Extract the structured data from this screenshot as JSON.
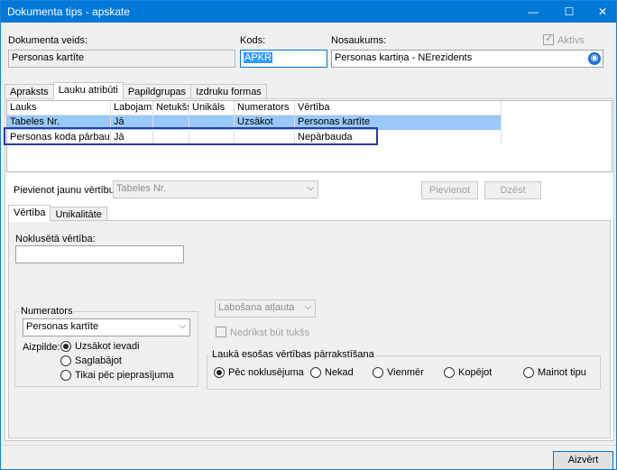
{
  "window": {
    "title": "Dokumenta tips - apskate",
    "minimize_glyph": "—",
    "maximize_glyph": "☐",
    "close_glyph": "✕"
  },
  "header": {
    "doc_type_label": "Dokumenta veids:",
    "doc_type_value": "Personas kartīte",
    "code_label": "Kods:",
    "code_value": "APKR",
    "name_label": "Nosaukums:",
    "name_value": "Personas kartiņa - NErezidents",
    "active_label": "Aktīvs",
    "active_checked": true
  },
  "main_tabs": [
    "Apraksts",
    "Lauku atribūti",
    "Papildgrupas",
    "Izdruku formas"
  ],
  "main_tab_active": 1,
  "grid": {
    "columns": [
      "Lauks",
      "Labojams",
      "Netukšs",
      "Unikāls",
      "Numerators",
      "Vērtība"
    ],
    "rows": [
      [
        "Tabeles Nr.",
        "Jā",
        "",
        "",
        "Uzsākot",
        "Personas kartīte"
      ],
      [
        "Personas koda pārbaude",
        "Jā",
        "",
        "",
        "",
        "Nepārbauda"
      ]
    ],
    "selected_row": 0
  },
  "add_value": {
    "label": "Pievienot jaunu vērtību:",
    "placeholder": "Tabeles Nr.",
    "add_button": "Pievienot",
    "delete_button": "Dzēst"
  },
  "sub_tabs": [
    "Vērtība",
    "Unikalitāte"
  ],
  "sub_tab_active": 0,
  "default_value": {
    "label": "Noklusētā vērtība:",
    "value": ""
  },
  "edit_select": {
    "value": "Labošana atļauta"
  },
  "not_empty": {
    "label": "Nedrīkst būt tukšs"
  },
  "numerator": {
    "group_label": "Numerators",
    "select_value": "Personas kartīte",
    "fill_label": "Aizpilde:",
    "options": [
      "Uzsākot ievadi",
      "Saglabājot",
      "Tikai pēc pieprasījuma"
    ],
    "selected": 0
  },
  "overwrite": {
    "group_label": "Laukā esošas vērtības pārrakstīšana",
    "options": [
      "Pēc noklusējuma",
      "Nekad",
      "Vienmēr",
      "Kopējot",
      "Mainot tipu"
    ],
    "selected": 0
  },
  "footer": {
    "close_button": "Aizvērt"
  },
  "colors": {
    "title_bar": "#0078d7",
    "selected_row": "#99c9f9",
    "highlight_box": "#2b3aa8"
  }
}
